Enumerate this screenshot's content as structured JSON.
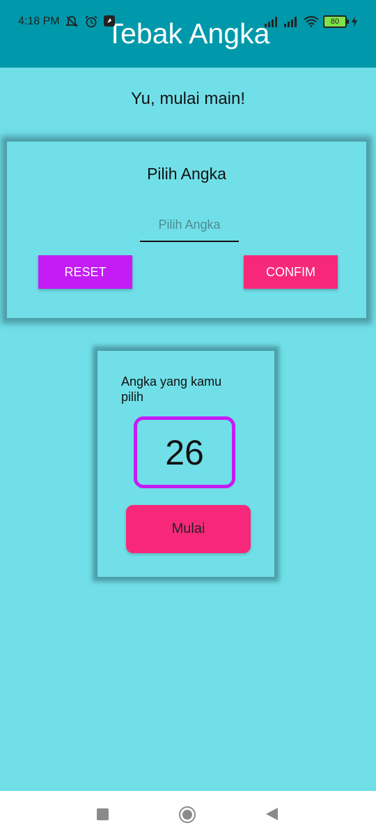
{
  "status_bar": {
    "time": "4:18 PM",
    "battery": "80",
    "icons": [
      "bell-off-icon",
      "alarm-icon",
      "app-notification-icon",
      "signal-icon",
      "signal-icon",
      "wifi-icon",
      "battery-icon",
      "charging-icon"
    ]
  },
  "app_bar": {
    "title": "Tebak Angka"
  },
  "greeting": "Yu, mulai main!",
  "input_card": {
    "title": "Pilih Angka",
    "input_placeholder": "Pilih Angka",
    "input_value": "",
    "reset_label": "RESET",
    "confirm_label": "CONFIM"
  },
  "result_card": {
    "label": "Angka yang kamu pilih",
    "number": "26",
    "start_label": "Mulai"
  },
  "colors": {
    "app_bar": "#0099ab",
    "background": "#71dfe8",
    "reset_button": "#c41cf5",
    "confirm_button": "#f7287a",
    "number_border": "#c41cf5"
  },
  "nav_bar": {
    "icons": [
      "recents-icon",
      "home-icon",
      "back-icon"
    ]
  }
}
